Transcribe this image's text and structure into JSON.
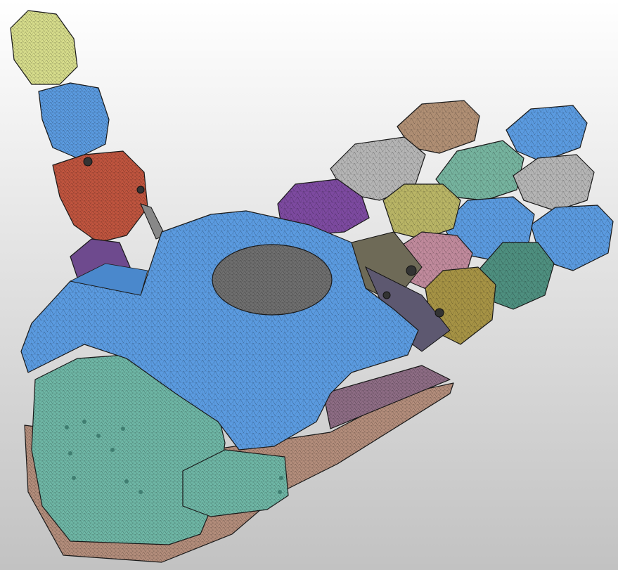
{
  "scene": {
    "model": "robotic-hand-fem-mesh",
    "background": [
      "#ffffff",
      "#c2c2c2"
    ],
    "mesh_line_color": "#1a1a1a"
  },
  "colors": {
    "shell_blue": "#5b9be0",
    "palm_insert_grey": "#6f6f6f",
    "wrist_teal": "#6fb7a6",
    "base_brown": "#b48e7c",
    "thumb_tip_yellow": "#d7dd8c",
    "thumb_mid_blue": "#5b9be0",
    "thumb_base_red": "#c0553f",
    "thumb_mount_purple": "#6e4a8e",
    "finger_tan": "#b08f74",
    "finger_grey": "#b5b5b5",
    "finger_teal": "#76b49f",
    "finger_yellow": "#b9b566",
    "finger_pink": "#c08a9c",
    "finger_olive": "#a69345",
    "finger_purple": "#7d4aa0",
    "finger_dark_teal": "#4e8f7f"
  },
  "parts": [
    "palm-shell",
    "palm-insert",
    "wrist-housing",
    "base-plate",
    "thumb-tip",
    "thumb-middle",
    "thumb-base",
    "thumb-mount",
    "index-finger",
    "middle-finger",
    "ring-finger",
    "little-finger"
  ]
}
